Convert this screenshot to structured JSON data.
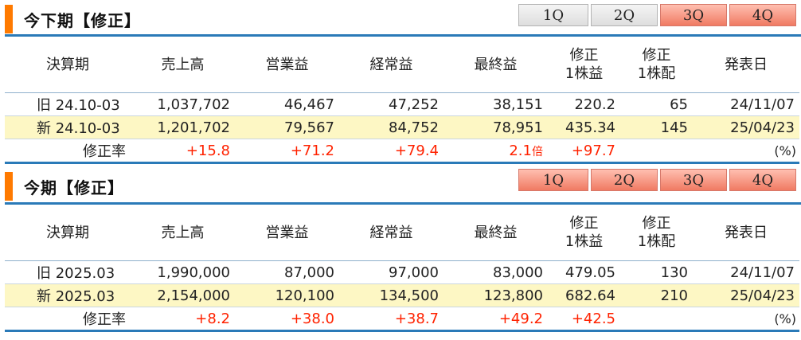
{
  "sections": [
    {
      "title": "今下期【修正】",
      "tabs": [
        {
          "label": "1Q",
          "style": "gray"
        },
        {
          "label": "2Q",
          "style": "gray"
        },
        {
          "label": "3Q",
          "style": "red"
        },
        {
          "label": "4Q",
          "style": "red"
        }
      ],
      "headers": [
        "決算期",
        "売上高",
        "営業益",
        "経常益",
        "最終益",
        "修正\n1株益",
        "修正\n1株配",
        "発表日"
      ],
      "rows": [
        {
          "label": "旧 24.10-03",
          "sales": "1,037,702",
          "op": "46,467",
          "ord": "47,252",
          "net": "38,151",
          "eps": "220.2",
          "div": "65",
          "date": "24/11/07"
        },
        {
          "label": "新 24.10-03",
          "sales": "1,201,702",
          "op": "79,567",
          "ord": "84,752",
          "net": "78,951",
          "eps": "435.34",
          "div": "145",
          "date": "25/04/23"
        }
      ],
      "rate": {
        "label": "修正率",
        "sales": "+15.8",
        "op": "+71.2",
        "ord": "+79.4",
        "net": "2.1",
        "net_unit": "倍",
        "eps": "+97.7",
        "unit": "(%)"
      }
    },
    {
      "title": "今期【修正】",
      "tabs": [
        {
          "label": "1Q",
          "style": "red"
        },
        {
          "label": "2Q",
          "style": "red"
        },
        {
          "label": "3Q",
          "style": "red"
        },
        {
          "label": "4Q",
          "style": "red"
        }
      ],
      "headers": [
        "決算期",
        "売上高",
        "営業益",
        "経常益",
        "最終益",
        "修正\n1株益",
        "修正\n1株配",
        "発表日"
      ],
      "rows": [
        {
          "label": "旧 2025.03",
          "sales": "1,990,000",
          "op": "87,000",
          "ord": "97,000",
          "net": "83,000",
          "eps": "479.05",
          "div": "130",
          "date": "24/11/07"
        },
        {
          "label": "新 2025.03",
          "sales": "2,154,000",
          "op": "120,100",
          "ord": "134,500",
          "net": "123,800",
          "eps": "682.64",
          "div": "210",
          "date": "25/04/23"
        }
      ],
      "rate": {
        "label": "修正率",
        "sales": "+8.2",
        "op": "+38.0",
        "ord": "+38.7",
        "net": "+49.2",
        "net_unit": "",
        "eps": "+42.5",
        "unit": "(%)"
      }
    }
  ],
  "colors": {
    "accent": "#ff7a00",
    "rule": "#2a7ab8",
    "highlight_row": "#fdf7c4",
    "positive": "#ff2200"
  }
}
